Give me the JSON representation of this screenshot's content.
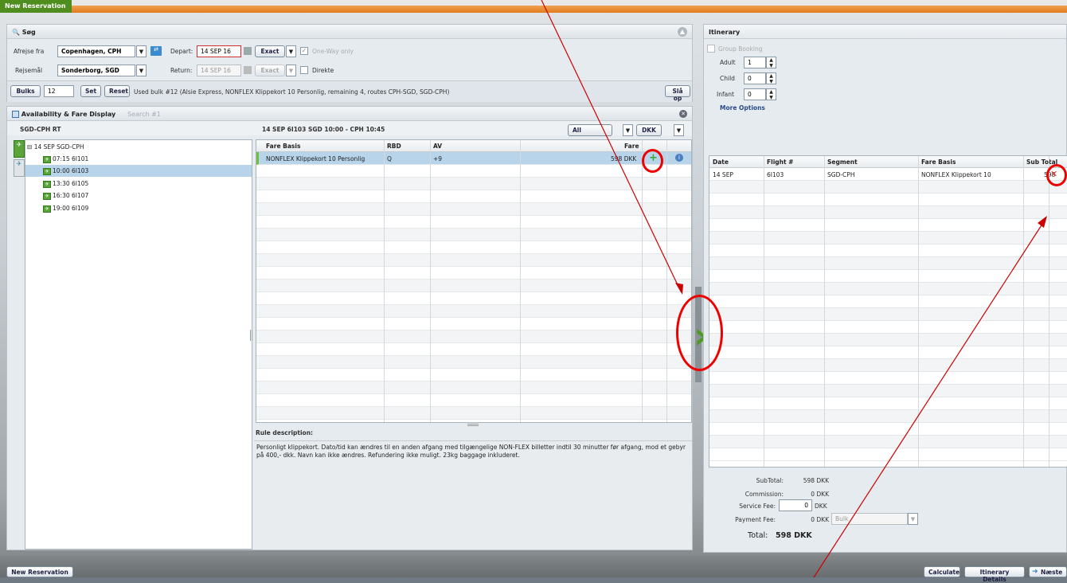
{
  "window": {
    "tab_title": "New Reservation",
    "bottom_tab": "New Reservation"
  },
  "search": {
    "header": "Søg",
    "from_label": "Afrejse fra",
    "from_value": "Copenhagen, CPH",
    "depart_label": "Depart:",
    "depart_value": "14 SEP 16",
    "depart_mode": "Exact",
    "oneway_label": "One-Way only",
    "to_label": "Rejsemål",
    "to_value": "Sonderborg, SGD",
    "return_label": "Return:",
    "return_value": "14 SEP 16",
    "return_mode": "Exact",
    "direct_label": "Direkte",
    "bulks_label": "Bulks",
    "bulks_value": "12",
    "set_label": "Set",
    "reset_label": "Reset",
    "bulk_info": "Used bulk #12 (Alsie Express, NONFLEX Klippekort 10 Personlig, remaining 4, routes CPH-SGD, SGD-CPH)",
    "lookup_label": "Slå op"
  },
  "availability": {
    "header": "Availability & Fare Display",
    "search_tab": "Search #1",
    "route": "SGD-CPH RT",
    "tree_root": "14 SEP SGD-CPH",
    "flights": [
      "07:15 6I101",
      "10:00 6I103",
      "13:30 6I105",
      "16:30 6I107",
      "19:00 6I109"
    ],
    "selected_flight_title": "14 SEP 6I103 SGD 10:00 - CPH 10:45",
    "filter": "All",
    "currency": "DKK",
    "columns": [
      "Fare Basis",
      "RBD",
      "AV",
      "Fare"
    ],
    "rows": [
      {
        "fare_basis": "NONFLEX Klippekort 10 Personlig",
        "rbd": "Q",
        "av": "+9",
        "fare": "598 DKK"
      }
    ],
    "rule_header": "Rule description:",
    "rule_text": "Personligt klippekort. Dato/tid kan ændres til en anden afgang med tilgængelige NON-FLEX billetter indtil 30 minutter før afgang, mod et gebyr på 400,- dkk. Navn kan ikke ændres. Refundering ikke muligt. 23kg baggage inkluderet."
  },
  "itinerary": {
    "header": "Itinerary",
    "group_booking": "Group Booking",
    "adult_label": "Adult",
    "adult": "1",
    "child_label": "Child",
    "child": "0",
    "infant_label": "Infant",
    "infant": "0",
    "more_options": "More Options",
    "columns": [
      "Date",
      "Flight #",
      "Segment",
      "Fare Basis",
      "Sub Total"
    ],
    "rows": [
      {
        "date": "14 SEP",
        "flight": "6I103",
        "segment": "SGD-CPH",
        "fare_basis": "NONFLEX Klippekort 10",
        "sub_total": "598"
      }
    ],
    "subtotal_label": "SubTotal:",
    "subtotal": "598 DKK",
    "commission_label": "Commission:",
    "commission": "0 DKK",
    "service_fee_label": "Service Fee:",
    "service_fee": "0",
    "service_fee_unit": "DKK",
    "payment_fee_label": "Payment Fee:",
    "payment_fee": "0 DKK",
    "payment_select": "Bulk",
    "total_label": "Total:",
    "total": "598 DKK"
  },
  "footer": {
    "calculate": "Calculate",
    "itinerary_details": "Itinerary Details",
    "next": "Næste"
  },
  "colors": {
    "accent_green": "#4f8d1f",
    "annotation_red": "#e00000",
    "selected_row": "#b7d4ea"
  }
}
